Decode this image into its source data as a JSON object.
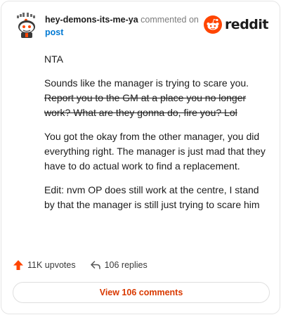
{
  "comment": {
    "username": "hey-demons-its-me-ya",
    "action": "commented on",
    "post_link": "post",
    "paragraphs": [
      {
        "text": "NTA"
      },
      {
        "text": "Sounds like the manager is trying to scare you.",
        "strike": "Report you to the GM at a place you no longer work? What are they gonna do, fire you? Lol"
      },
      {
        "text": "You got the okay from the other manager, you did everything right. The manager is just mad that they have to do actual work to find a replacement."
      },
      {
        "text": "Edit: nvm OP does still work at the centre, I stand by that the manager is still just trying to scare him"
      }
    ]
  },
  "brand": {
    "name": "reddit",
    "color": "#ff4500"
  },
  "stats": {
    "upvotes": "11K upvotes",
    "replies": "106 replies"
  },
  "actions": {
    "view_comments": "View 106 comments"
  },
  "colors": {
    "accent": "#d93900",
    "link": "#0079d3"
  }
}
